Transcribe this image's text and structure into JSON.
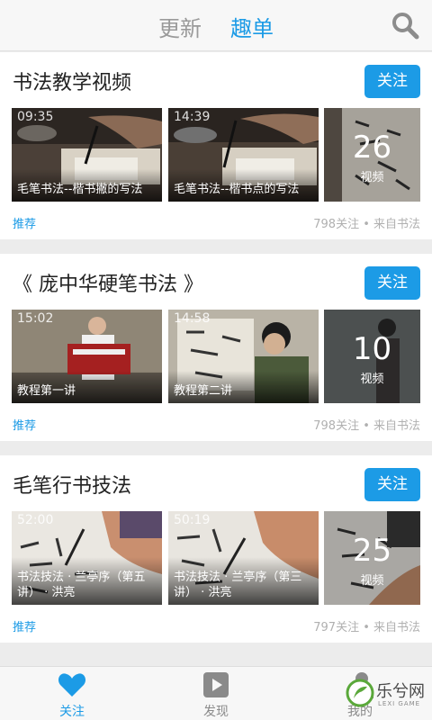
{
  "header": {
    "tabs": [
      {
        "label": "更新",
        "active": false
      },
      {
        "label": "趣单",
        "active": true
      }
    ],
    "search_icon": "search-icon"
  },
  "accent_color": "#1c9be6",
  "cards": [
    {
      "title": "书法教学视频",
      "follow_label": "关注",
      "videos": [
        {
          "duration": "09:35",
          "title": "毛笔书法--楷书撇的写法"
        },
        {
          "duration": "14:39",
          "title": "毛笔书法--楷书点的写法"
        }
      ],
      "count": "26",
      "count_label": "视频",
      "tag": "推荐",
      "meta": "798关注 • 来自书法"
    },
    {
      "title": "《 庞中华硬笔书法 》",
      "follow_label": "关注",
      "videos": [
        {
          "duration": "15:02",
          "title": "教程第一讲"
        },
        {
          "duration": "14:58",
          "title": "教程第二讲"
        }
      ],
      "count": "10",
      "count_label": "视频",
      "tag": "推荐",
      "meta": "798关注 • 来自书法"
    },
    {
      "title": "毛笔行书技法",
      "follow_label": "关注",
      "videos": [
        {
          "duration": "52:00",
          "title": "书法技法 · 兰亭序（第五讲） · 洪亮"
        },
        {
          "duration": "50:19",
          "title": "书法技法 · 兰亭序（第三讲） · 洪亮"
        }
      ],
      "count": "25",
      "count_label": "视频",
      "tag": "推荐",
      "meta": "797关注 • 来自书法"
    }
  ],
  "bottom_nav": [
    {
      "label": "关注",
      "icon": "heart-icon",
      "active": true
    },
    {
      "label": "发现",
      "icon": "play-icon",
      "active": false
    },
    {
      "label": "我的",
      "icon": "person-icon",
      "active": false
    }
  ],
  "watermark": {
    "text": "乐兮网",
    "sub": "LEXI GAME"
  }
}
